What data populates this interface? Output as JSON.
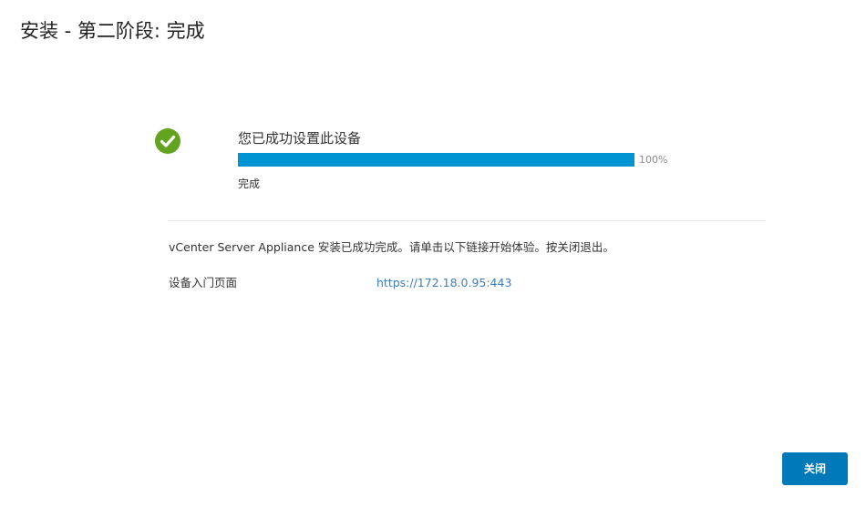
{
  "page": {
    "title": "安装 - 第二阶段: 完成"
  },
  "status": {
    "icon": "check-circle-icon",
    "icon_color": "#62a420",
    "heading": "您已成功设置此设备",
    "progress_value": 100,
    "progress_label": "100%",
    "progress_color": "#0094d2",
    "sub_status": "完成"
  },
  "message": "vCenter Server Appliance 安装已成功完成。请单击以下链接开始体验。按关闭退出。",
  "portal": {
    "label": "设备入门页面",
    "url": "https://172.18.0.95:443"
  },
  "footer": {
    "close_label": "关闭",
    "button_color": "#0079b8"
  }
}
